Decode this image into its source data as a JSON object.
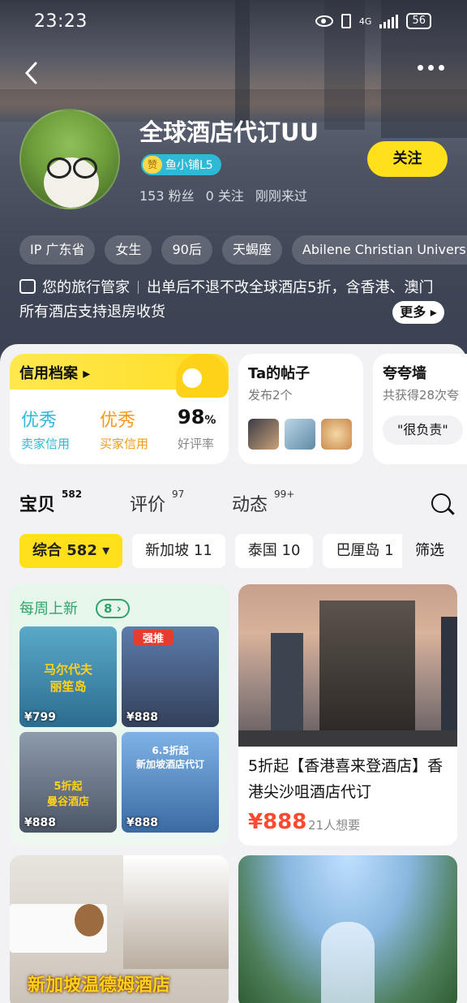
{
  "status_bar": {
    "time": "23:23",
    "network": "4G",
    "battery": "56"
  },
  "profile": {
    "name": "全球酒店代订UU",
    "badge_icon_text": "赞",
    "badge": "鱼小铺L5",
    "fans": "153 粉丝",
    "following": "0 关注",
    "last_seen": "刚刚来过",
    "follow_label": "关注",
    "tags": [
      "IP 广东省",
      "女生",
      "90后",
      "天蝎座",
      "Abilene Christian University"
    ],
    "bio_label": "您的旅行管家",
    "bio_text": "出单后不退不改全球酒店5折，含香港、澳门所有酒店支持退房收货",
    "more_label": "更多"
  },
  "credit": {
    "title": "信用档案",
    "seller_value": "优秀",
    "seller_label": "卖家信用",
    "buyer_value": "优秀",
    "buyer_label": "买家信用",
    "rate_value": "98",
    "rate_unit": "%",
    "rate_label": "好评率"
  },
  "posts": {
    "title": "Ta的帖子",
    "subtitle": "发布2个"
  },
  "praise": {
    "title": "夸夸墙",
    "subtitle": "共获得28次夸",
    "quote": "\"很负责\""
  },
  "tabs": [
    {
      "label": "宝贝",
      "count": "582"
    },
    {
      "label": "评价",
      "count": "97"
    },
    {
      "label": "动态",
      "count": "99+"
    }
  ],
  "chips": [
    "综合 582",
    "新加坡 11",
    "泰国 10",
    "巴厘岛 1"
  ],
  "filter_label": "筛选",
  "weekly": {
    "title": "每周上新",
    "count": "8",
    "items": [
      {
        "caption": "马尔代夫\n丽笙岛",
        "price": "¥799",
        "colors": [
          "#5aa9c9",
          "#2b6c8f"
        ]
      },
      {
        "caption": "强推",
        "price": "¥888",
        "colors": [
          "#5c7cab",
          "#33405a"
        ]
      },
      {
        "caption": "5折起\n曼谷酒店",
        "price": "¥888",
        "colors": [
          "#8e9bad",
          "#4b5566"
        ]
      },
      {
        "caption": "6.5折起\n新加坡酒店代订",
        "price": "¥888",
        "colors": [
          "#7fb3e8",
          "#3a6aa1"
        ]
      }
    ]
  },
  "product": {
    "title": "5折起【香港喜来登酒店】香港尖沙咀酒店代订",
    "price": "¥888",
    "wants": "21人想要"
  },
  "card3_caption": "新加坡温德姆酒店",
  "colors": {
    "accent": "#ffe01a",
    "price": "#ff4a31",
    "credit_blue": "#2fb9d6",
    "credit_orange": "#f39a1c",
    "green": "#2fa36b"
  }
}
